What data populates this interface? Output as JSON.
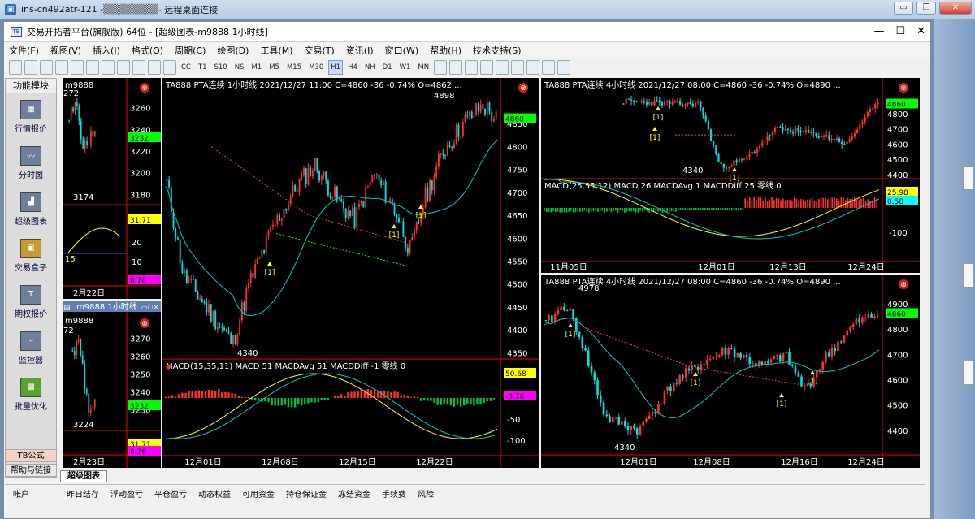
{
  "rdp": {
    "title": "ins-cn492atr-121 - ",
    "masked": "▒▒▒▒▒▒▒▒",
    "title2": " - 远程桌面连接",
    "btn_min": "▭",
    "btn_restore": "❐",
    "btn_close": "✕"
  },
  "app": {
    "title": "交易开拓者平台(旗舰版) 64位 - [超级图表-m9888 1小时线]",
    "icon": "TB"
  },
  "menu": [
    "文件(F)",
    "视图(V)",
    "插入(I)",
    "格式(O)",
    "周期(C)",
    "绘图(D)",
    "工具(M)",
    "交易(T)",
    "资讯(I)",
    "窗口(W)",
    "帮助(H)",
    "技术支持(S)"
  ],
  "periods": [
    "T1",
    "S10",
    "NS",
    "M1",
    "M5",
    "M15",
    "M30",
    "H1",
    "H4",
    "NH",
    "D1",
    "W1",
    "MN"
  ],
  "active_period": "H1",
  "cc_label": "CC",
  "sidebar": {
    "head": "功能模块",
    "items": [
      {
        "label": "行情报价",
        "icon": "table-icon"
      },
      {
        "label": "分时图",
        "icon": "intraday-icon"
      },
      {
        "label": "超级图表",
        "icon": "chart-icon"
      },
      {
        "label": "交易盒子",
        "icon": "box-icon"
      },
      {
        "label": "期权报价",
        "icon": "option-icon"
      },
      {
        "label": "监控器",
        "icon": "monitor-icon"
      },
      {
        "label": "批量优化",
        "icon": "optimize-icon"
      }
    ],
    "tb": "TB公式",
    "help": "帮助与链接"
  },
  "tab": "超级图表",
  "status": [
    "帐户",
    "昨日结存",
    "浮动盈亏",
    "平仓盈亏",
    "动态权益",
    "可用资金",
    "持仓保证金",
    "冻结资金",
    "手续费",
    "风险"
  ],
  "left_top": {
    "title": "m9888",
    "ticks": [
      "3260",
      "3240",
      "3232",
      "3220",
      "3200",
      "3180"
    ],
    "hi": "272",
    "lo": "3174",
    "sub": [
      "31.71",
      "20",
      "15",
      "10",
      "0.76"
    ],
    "date": "2月22日"
  },
  "left_bottom": {
    "window": "m9888 1小时线",
    "title": "m9888",
    "ticks": [
      "3270",
      "3260",
      "3250",
      "3240",
      "3232",
      "3230"
    ],
    "hi": "72",
    "lo": "3224",
    "sub": [
      "31.71",
      "0.76"
    ],
    "date": "2月23日"
  },
  "main": {
    "header": "TA888 PTA连续 1小时线 2021/12/27 11:00 C=4860 -36 -0.74% O=4862 ...",
    "hi": "4898",
    "lo": "4340",
    "price_tag": "4860",
    "ticks": [
      "4850",
      "4800",
      "4750",
      "4700",
      "4650",
      "4600",
      "4550",
      "4500",
      "4450",
      "4400",
      "4350"
    ],
    "macd": "MACD(15,35,11) MACD 51 MACDAvg 51 MACDDiff -1 零线 0",
    "macd_tags": [
      "50.68",
      "-0.76",
      "-50",
      "-100"
    ],
    "dates": [
      "12月01日",
      "12月08日",
      "12月15日",
      "12月22日"
    ],
    "marker": "[1]"
  },
  "rt": {
    "header": "TA888 PTA连续 4小时线 2021/12/27 08:00 C=4860 -36 -0.74% O=4890 ...",
    "lo": "4340",
    "price_tag": "4860",
    "ticks": [
      "4800",
      "4700",
      "4600",
      "4500",
      "4400"
    ],
    "macd": "MACD(25,55,12) MACD 26 MACDAvg 1 MACDDiff 25 零线 0",
    "macd_tags": [
      "25.98",
      "0.58",
      "-100"
    ],
    "dates": [
      "11月05日",
      "12月01日",
      "12月13日",
      "12月24日"
    ],
    "marker": "[1]"
  },
  "rb": {
    "header": "TA888 PTA连续 4小时线 2021/12/27 08:00 C=4860 -36 -0.74% O=4890 ...",
    "hi": "4978",
    "lo": "4340",
    "price_tag": "4860",
    "ticks": [
      "4900",
      "4800",
      "4700",
      "4600",
      "4500",
      "4400"
    ],
    "dates": [
      "12月01日",
      "12月08日",
      "12月16日",
      "12月24日"
    ],
    "marker": "[1]"
  },
  "colors": {
    "up": "#ff3030",
    "down": "#00e0e0",
    "ma1": "#ffff00",
    "ma2": "#00c8c8",
    "bg": "#000000",
    "axis": "#ff0000"
  }
}
